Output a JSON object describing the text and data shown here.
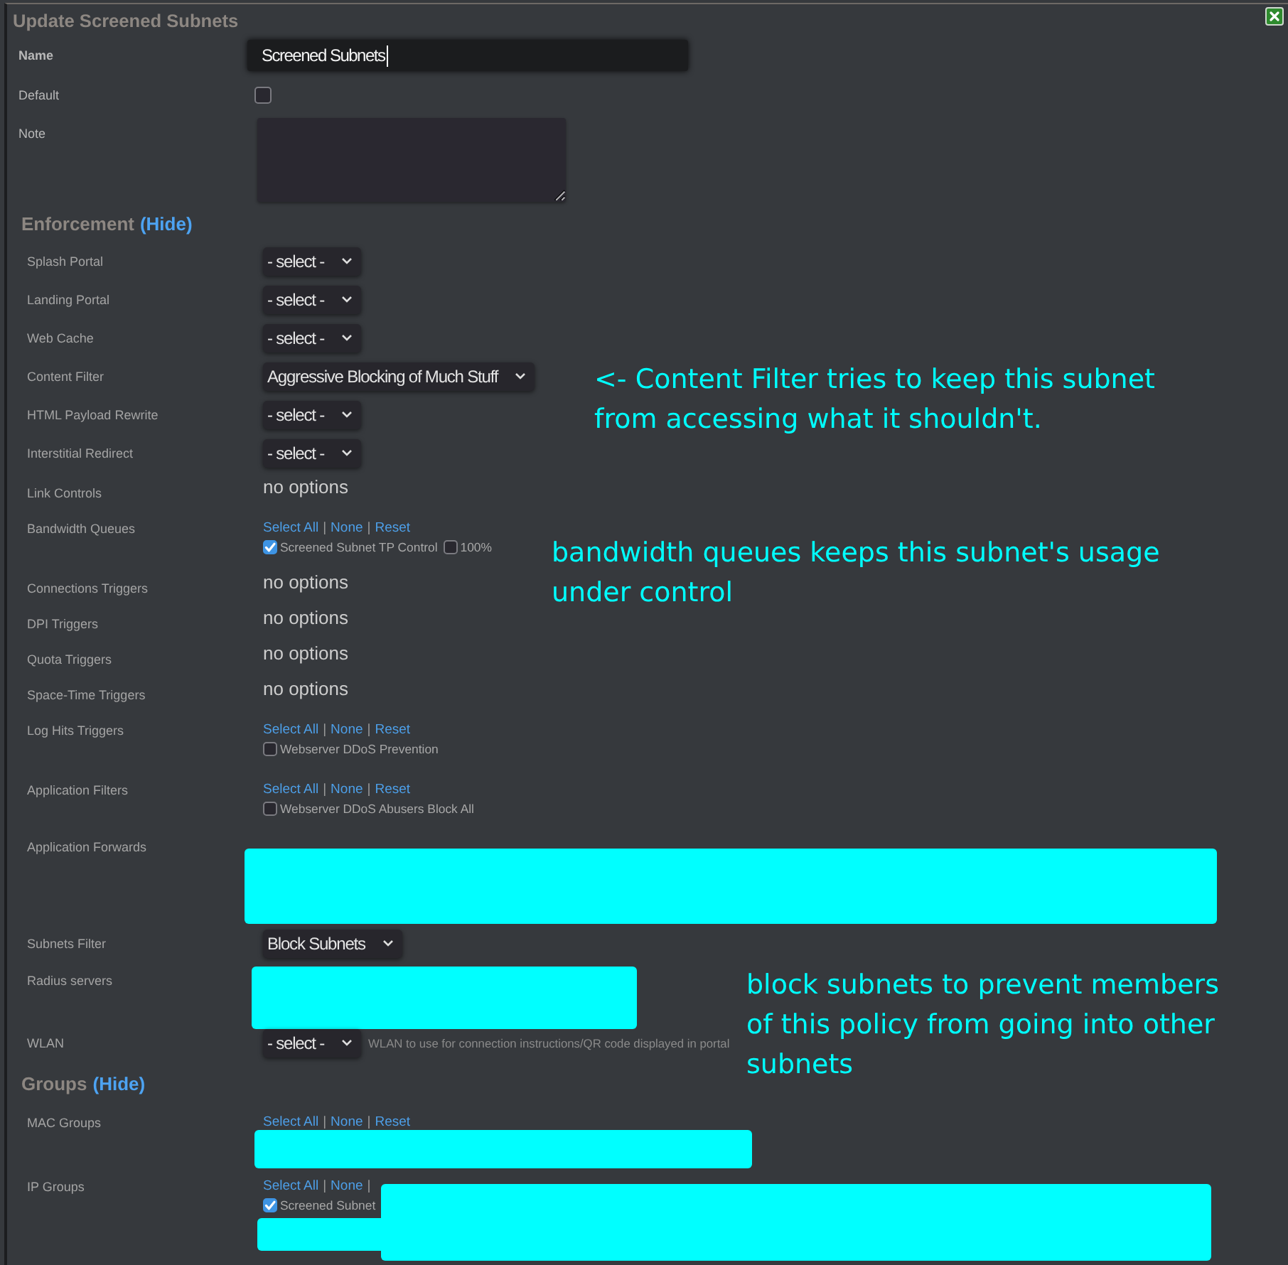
{
  "dialog": {
    "title": "Update Screened Subnets"
  },
  "fields": [
    {
      "kind": "text",
      "label": "Name",
      "value": "Screened Subnets"
    },
    {
      "kind": "checkbox",
      "label": "Default",
      "checked": false
    },
    {
      "kind": "textarea",
      "label": "Note"
    }
  ],
  "sections": [
    {
      "title": "Enforcement",
      "toggle": "(Hide)",
      "rows": [
        {
          "kind": "select",
          "label": "Splash Portal",
          "value": "- select -"
        },
        {
          "kind": "select",
          "label": "Landing Portal",
          "value": "- select -"
        },
        {
          "kind": "select",
          "label": "Web Cache",
          "value": "- select -"
        },
        {
          "kind": "select",
          "label": "Content Filter",
          "value": "Aggressive Blocking of Much Stuff"
        },
        {
          "kind": "select",
          "label": "HTML Payload Rewrite",
          "value": "- select -"
        },
        {
          "kind": "select",
          "label": "Interstitial Redirect",
          "value": "- select -"
        },
        {
          "kind": "text",
          "label": "Link Controls",
          "value": "no options"
        },
        {
          "kind": "checklist",
          "label": "Bandwidth Queues",
          "links": [
            {
              "label": "Select All"
            },
            {
              "separator": "|",
              "label": "None"
            },
            {
              "separator": "|",
              "label": "Reset"
            }
          ],
          "items": [
            {
              "label": "Screened Subnet TP Control",
              "checked": true
            },
            {
              "label": "100%",
              "checked": false
            }
          ],
          "redacted": false
        },
        {
          "kind": "text",
          "label": "Connections Triggers",
          "value": "no options"
        },
        {
          "kind": "text",
          "label": "DPI Triggers",
          "value": "no options"
        },
        {
          "kind": "text",
          "label": "Quota Triggers",
          "value": "no options"
        },
        {
          "kind": "text",
          "label": "Space-Time Triggers",
          "value": "no options"
        },
        {
          "kind": "checklist",
          "label": "Log Hits Triggers",
          "links": [
            {
              "label": "Select All"
            },
            {
              "separator": "|",
              "label": "None"
            },
            {
              "separator": "|",
              "label": "Reset"
            }
          ],
          "items": [
            {
              "label": "Webserver DDoS Prevention",
              "checked": false
            }
          ],
          "redacted": false
        },
        {
          "kind": "checklist",
          "label": "Application Filters",
          "links": [
            {
              "label": "Select All"
            },
            {
              "separator": "|",
              "label": "None"
            },
            {
              "separator": "|",
              "label": "Reset"
            }
          ],
          "items": [
            {
              "label": "Webserver DDoS Abusers Block All",
              "checked": false
            }
          ],
          "redacted": false
        },
        {
          "kind": "redacted",
          "label": "Application Forwards"
        },
        {
          "kind": "select",
          "label": "Subnets Filter",
          "value": "Block Subnets"
        },
        {
          "kind": "redacted",
          "label": "Radius servers"
        },
        {
          "kind": "select",
          "label": "WLAN",
          "value": "- select -",
          "hint": "WLAN to use for connection instructions/QR code displayed in portal"
        }
      ]
    },
    {
      "title": "Groups",
      "toggle": "(Hide)",
      "rows": [
        {
          "kind": "checklist",
          "label": "MAC Groups",
          "links": [
            {
              "label": "Select All"
            },
            {
              "separator": "|",
              "label": "None"
            },
            {
              "separator": "|",
              "label": "Reset"
            }
          ],
          "items": [],
          "redacted": true
        },
        {
          "kind": "checklist",
          "label": "IP Groups",
          "links": [
            {
              "label": "Select All"
            },
            {
              "separator": "|",
              "label": "None"
            },
            {
              "separator": "|"
            }
          ],
          "items": [
            {
              "label": "Screened Subnet",
              "checked": true
            }
          ],
          "redacted": true
        }
      ]
    }
  ],
  "annotations": [
    {
      "text": "<- Content Filter tries to keep this subnet from accessing what it shouldn't."
    },
    {
      "text": "bandwidth queues keeps this subnet's usage under control"
    },
    {
      "text": "block subnets to prevent members of this policy from going into other subnets"
    }
  ]
}
